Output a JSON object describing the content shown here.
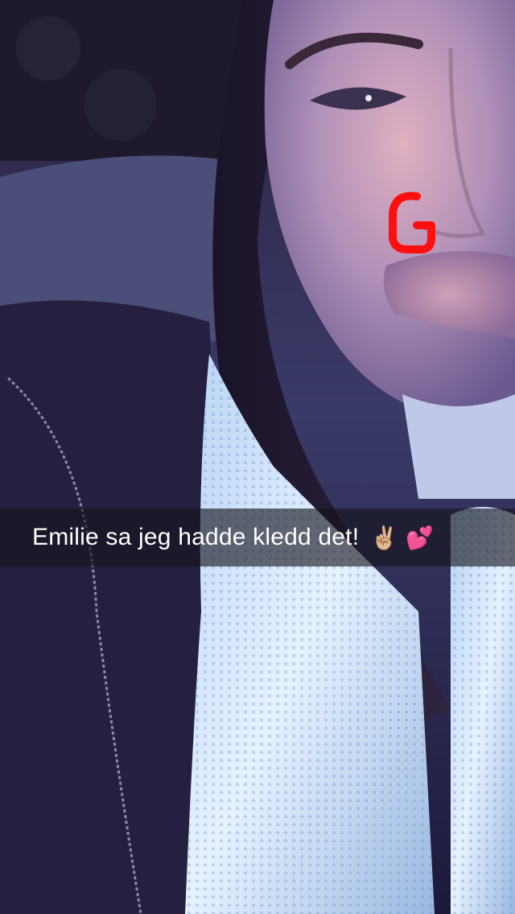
{
  "snap": {
    "caption": "Emilie sa jeg hadde kledd det!",
    "caption_emoji": "✌🏼 💕"
  },
  "doodle": {
    "letter": "G",
    "color": "#ff1010"
  }
}
